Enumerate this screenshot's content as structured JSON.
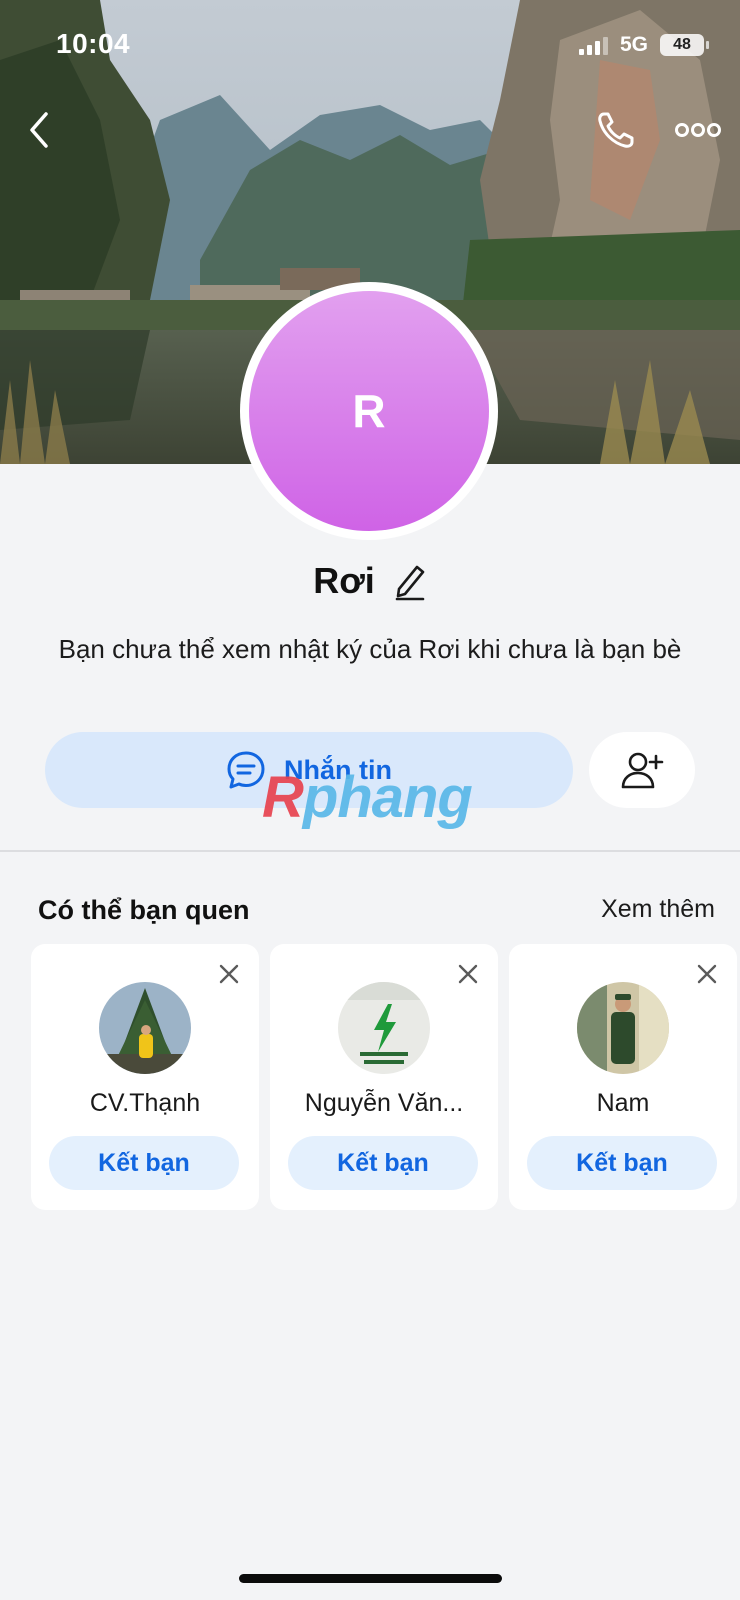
{
  "status_bar": {
    "time": "10:04",
    "network": "5G",
    "battery": "48"
  },
  "profile": {
    "avatar_letter": "R",
    "name": "Rơi",
    "info_text": "Bạn chưa thể xem nhật ký của Rơi khi chưa là bạn bè"
  },
  "actions": {
    "message_label": "Nhắn tin"
  },
  "watermark": {
    "first": "R",
    "rest": "phang"
  },
  "suggestions": {
    "title": "Có thể bạn quen",
    "see_more": "Xem thêm",
    "items": [
      {
        "name": "CV.Thạnh",
        "button": "Kết bạn"
      },
      {
        "name": "Nguyễn Văn...",
        "button": "Kết bạn"
      },
      {
        "name": "Nam",
        "button": "Kết bạn"
      }
    ]
  },
  "colors": {
    "accent": "#1266e0",
    "avatar_top": "#e2a0ef",
    "avatar_bottom": "#cf63e6",
    "message_button_bg": "#d9e8fb",
    "page_bg": "#f3f4f6"
  },
  "icons": [
    "chevron-left-icon",
    "phone-icon",
    "more-icon",
    "edit-pencil-icon",
    "chat-bubble-icon",
    "add-user-icon",
    "close-icon"
  ]
}
